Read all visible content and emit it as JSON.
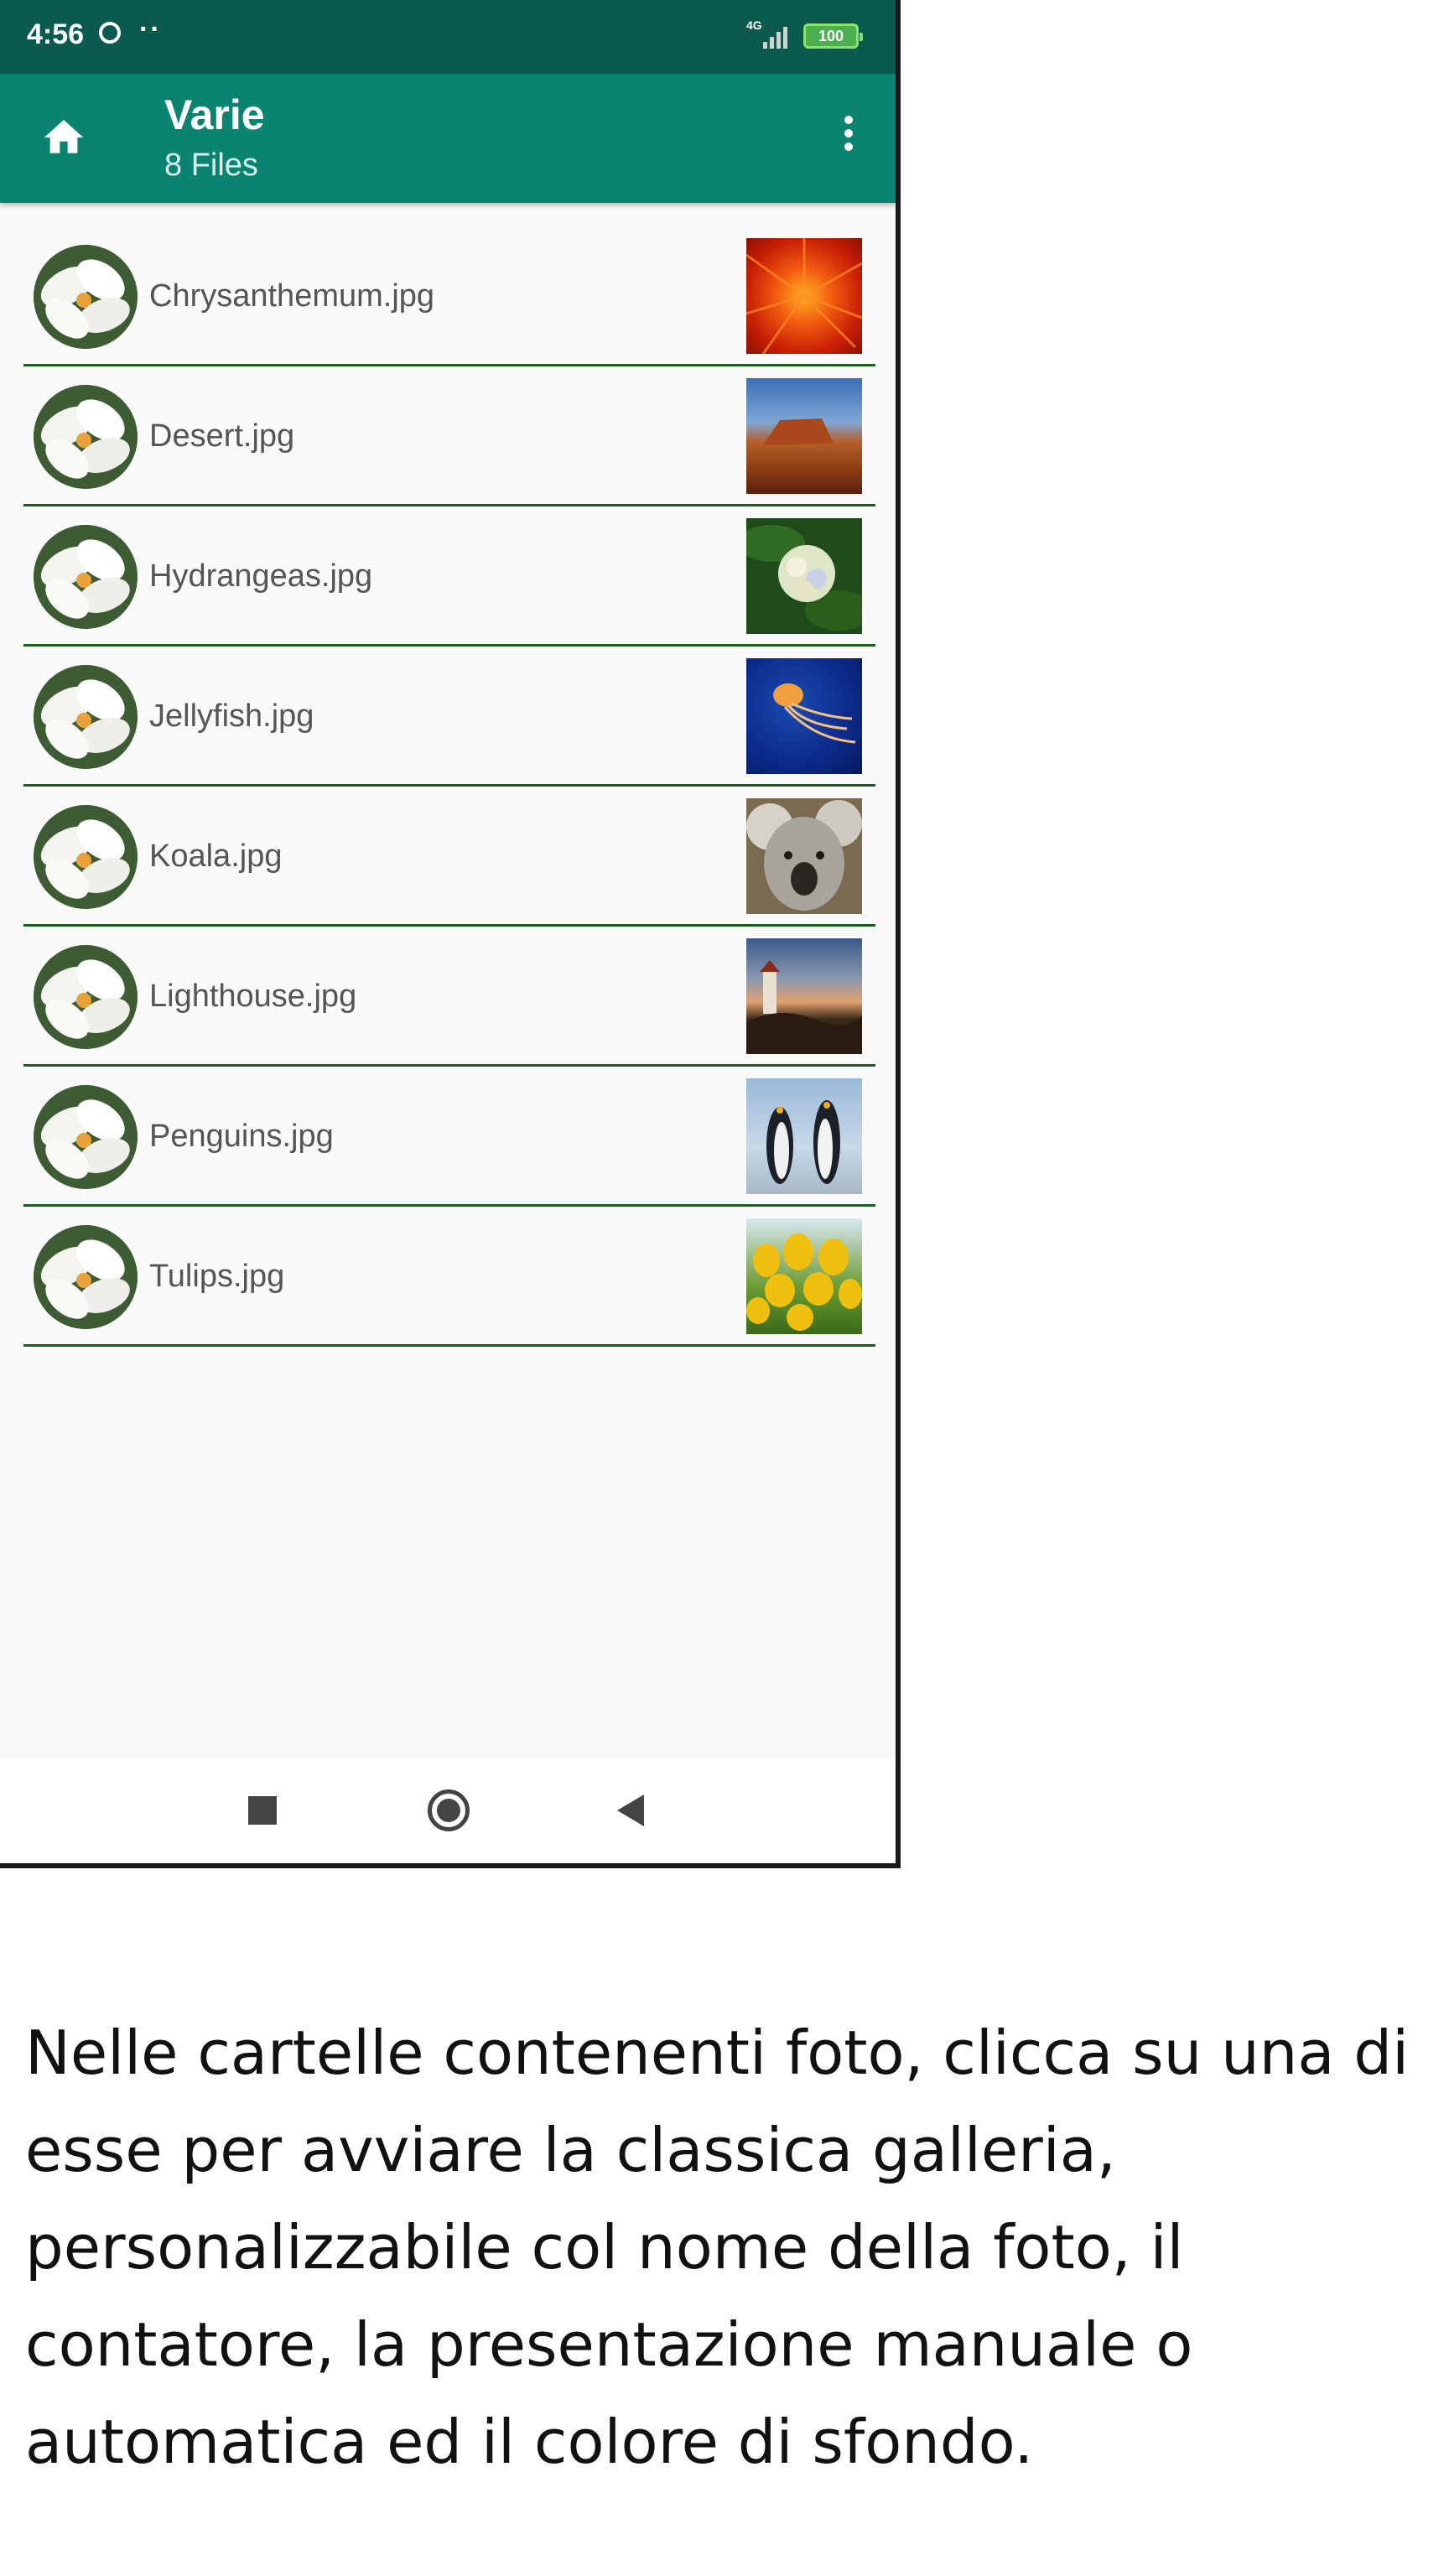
{
  "status_bar": {
    "time": "4:56",
    "dots": "··",
    "network": "4G",
    "battery": "100"
  },
  "app_bar": {
    "title": "Varie",
    "subtitle": "8 Files",
    "icons": {
      "home": "home-icon",
      "menu": "more-vert-icon"
    }
  },
  "files": [
    {
      "name": "Chrysanthemum.jpg",
      "thumb": "chrysanthemum"
    },
    {
      "name": "Desert.jpg",
      "thumb": "desert"
    },
    {
      "name": "Hydrangeas.jpg",
      "thumb": "hydrangeas"
    },
    {
      "name": "Jellyfish.jpg",
      "thumb": "jellyfish"
    },
    {
      "name": "Koala.jpg",
      "thumb": "koala"
    },
    {
      "name": "Lighthouse.jpg",
      "thumb": "lighthouse"
    },
    {
      "name": "Penguins.jpg",
      "thumb": "penguins"
    },
    {
      "name": "Tulips.jpg",
      "thumb": "tulips"
    }
  ],
  "nav_bar": {
    "icons": [
      "recent-apps-icon",
      "home-circle-icon",
      "back-triangle-icon"
    ]
  },
  "caption": "Nelle cartelle contenenti foto, clicca su una di esse per avviare la classica galleria, personalizzabile col nome della foto, il contatore, la presentazione manuale o automatica ed il colore di sfondo.",
  "colors": {
    "status_bar": "#0a5b4e",
    "app_bar": "#0b8371",
    "divider": "#1b5e20",
    "list_background": "#fafafa"
  }
}
